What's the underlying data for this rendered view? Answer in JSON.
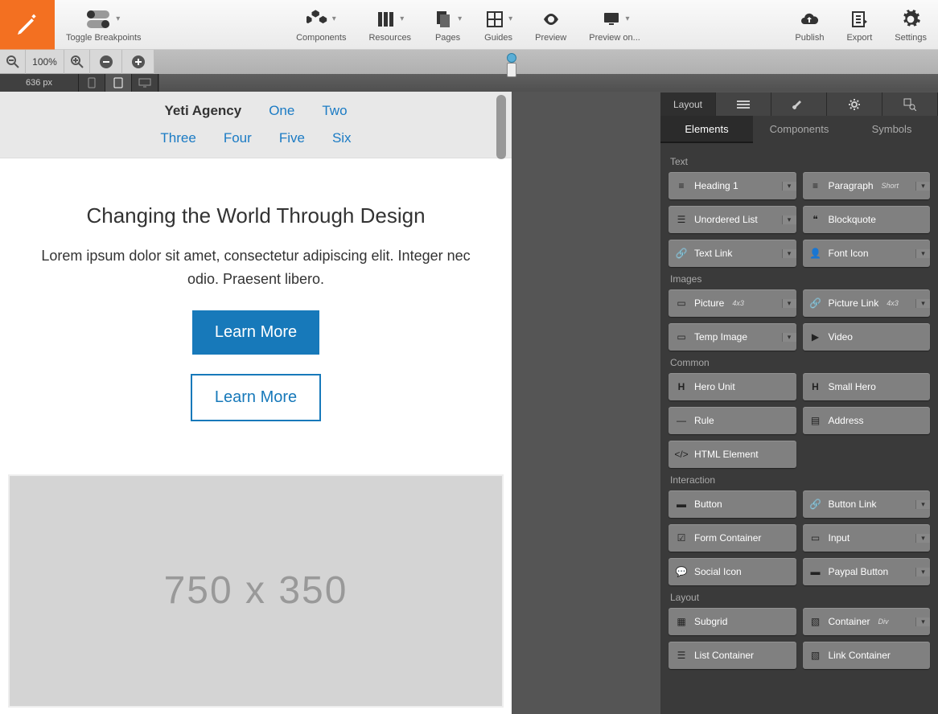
{
  "toolbar": {
    "breakpoints": "Toggle Breakpoints",
    "components": "Components",
    "resources": "Resources",
    "pages": "Pages",
    "guides": "Guides",
    "preview": "Preview",
    "preview_on": "Preview on...",
    "publish": "Publish",
    "export": "Export",
    "settings": "Settings"
  },
  "zoom": {
    "value": "100%",
    "width_px": "636 px"
  },
  "sidebar": {
    "toprow": {
      "layout": "Layout"
    },
    "tabs": {
      "elements": "Elements",
      "components": "Components",
      "symbols": "Symbols"
    },
    "sections": {
      "text": "Text",
      "images": "Images",
      "common": "Common",
      "interaction": "Interaction",
      "layout": "Layout"
    },
    "elements": {
      "heading1": "Heading 1",
      "paragraph": "Paragraph",
      "paragraph_sub": "Short",
      "ul": "Unordered List",
      "blockquote": "Blockquote",
      "textlink": "Text Link",
      "fonticon": "Font Icon",
      "picture": "Picture",
      "picture_sub": "4x3",
      "picturelink": "Picture Link",
      "picturelink_sub": "4x3",
      "tempimage": "Temp Image",
      "video": "Video",
      "hero": "Hero Unit",
      "smallhero": "Small Hero",
      "rule": "Rule",
      "address": "Address",
      "html": "HTML Element",
      "button": "Button",
      "buttonlink": "Button Link",
      "formcontainer": "Form Container",
      "input": "Input",
      "socialicon": "Social Icon",
      "paypal": "Paypal Button",
      "subgrid": "Subgrid",
      "container": "Container",
      "container_sub": "Div",
      "listcontainer": "List Container",
      "linkcontainer": "Link Container"
    }
  },
  "canvas": {
    "brand": "Yeti Agency",
    "nav": {
      "one": "One",
      "two": "Two",
      "three": "Three",
      "four": "Four",
      "five": "Five",
      "six": "Six"
    },
    "hero_title": "Changing the World Through Design",
    "hero_text": "Lorem ipsum dolor sit amet, consectetur adipiscing elit. Integer nec odio. Praesent libero.",
    "btn1": "Learn More",
    "btn2": "Learn More",
    "placeholder": "750 x 350"
  }
}
